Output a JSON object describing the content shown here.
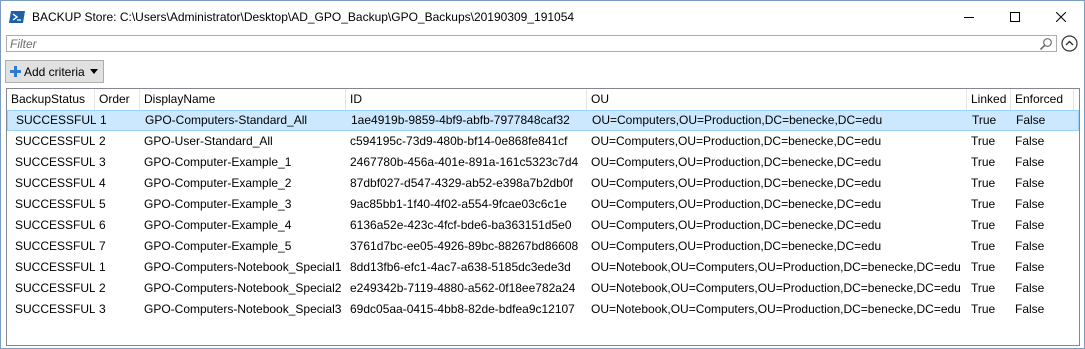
{
  "window": {
    "title": "BACKUP Store: C:\\Users\\Administrator\\Desktop\\AD_GPO_Backup\\GPO_Backups\\20190309_191054"
  },
  "filter": {
    "placeholder": "Filter",
    "value": ""
  },
  "toolbar": {
    "add_criteria_label": "Add criteria"
  },
  "colors": {
    "selected_row_bg": "#cce8ff",
    "selected_row_border": "#99d1ff",
    "powershell_icon": "#1f5fa8",
    "plus_icon": "#2f7bd1"
  },
  "grid": {
    "columns": [
      "BackupStatus",
      "Order",
      "DisplayName",
      "ID",
      "OU",
      "Linked",
      "Enforced"
    ],
    "selected_row": 0,
    "rows": [
      {
        "status": "SUCCESSFUL",
        "order": "1",
        "name": "GPO-Computers-Standard_All",
        "id": "1ae4919b-9859-4bf9-abfb-7977848caf32",
        "ou": "OU=Computers,OU=Production,DC=benecke,DC=edu",
        "linked": "True",
        "enforced": "False"
      },
      {
        "status": "SUCCESSFUL",
        "order": "2",
        "name": "GPO-User-Standard_All",
        "id": "c594195c-73d9-480b-bf14-0e868fe841cf",
        "ou": "OU=Computers,OU=Production,DC=benecke,DC=edu",
        "linked": "True",
        "enforced": "False"
      },
      {
        "status": "SUCCESSFUL",
        "order": "3",
        "name": "GPO-Computer-Example_1",
        "id": "2467780b-456a-401e-891a-161c5323c7d4",
        "ou": "OU=Computers,OU=Production,DC=benecke,DC=edu",
        "linked": "True",
        "enforced": "False"
      },
      {
        "status": "SUCCESSFUL",
        "order": "4",
        "name": "GPO-Computer-Example_2",
        "id": "87dbf027-d547-4329-ab52-e398a7b2db0f",
        "ou": "OU=Computers,OU=Production,DC=benecke,DC=edu",
        "linked": "True",
        "enforced": "False"
      },
      {
        "status": "SUCCESSFUL",
        "order": "5",
        "name": "GPO-Computer-Example_3",
        "id": "9ac85bb1-1f40-4f02-a554-9fcae03c6c1e",
        "ou": "OU=Computers,OU=Production,DC=benecke,DC=edu",
        "linked": "True",
        "enforced": "False"
      },
      {
        "status": "SUCCESSFUL",
        "order": "6",
        "name": "GPO-Computer-Example_4",
        "id": "6136a52e-423c-4fcf-bde6-ba363151d5e0",
        "ou": "OU=Computers,OU=Production,DC=benecke,DC=edu",
        "linked": "True",
        "enforced": "False"
      },
      {
        "status": "SUCCESSFUL",
        "order": "7",
        "name": "GPO-Computer-Example_5",
        "id": "3761d7bc-ee05-4926-89bc-88267bd86608",
        "ou": "OU=Computers,OU=Production,DC=benecke,DC=edu",
        "linked": "True",
        "enforced": "False"
      },
      {
        "status": "SUCCESSFUL",
        "order": "1",
        "name": "GPO-Computers-Notebook_Special1",
        "id": "8dd13fb6-efc1-4ac7-a638-5185dc3ede3d",
        "ou": "OU=Notebook,OU=Computers,OU=Production,DC=benecke,DC=edu",
        "linked": "True",
        "enforced": "False"
      },
      {
        "status": "SUCCESSFUL",
        "order": "2",
        "name": "GPO-Computers-Notebook_Special2",
        "id": "e249342b-7119-4880-a562-0f18ee782a24",
        "ou": "OU=Notebook,OU=Computers,OU=Production,DC=benecke,DC=edu",
        "linked": "True",
        "enforced": "False"
      },
      {
        "status": "SUCCESSFUL",
        "order": "3",
        "name": "GPO-Computers-Notebook_Special3",
        "id": "69dc05aa-0415-4bb8-82de-bdfea9c12107",
        "ou": "OU=Notebook,OU=Computers,OU=Production,DC=benecke,DC=edu",
        "linked": "True",
        "enforced": "False"
      }
    ]
  }
}
